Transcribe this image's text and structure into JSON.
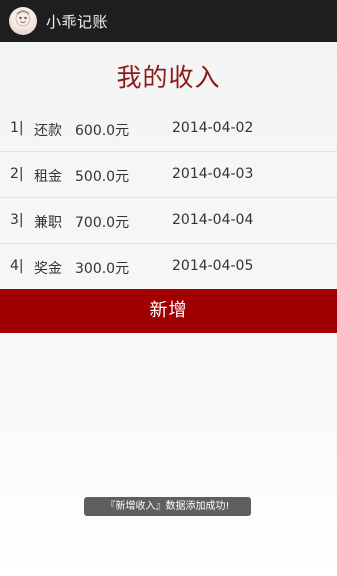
{
  "actionbar": {
    "app_title": "小乖记账",
    "app_icon": "app-logo-icon"
  },
  "page": {
    "title": "我的收入"
  },
  "income_list": [
    {
      "index": "1|",
      "category": "还款",
      "amount": "600.0元",
      "date": "2014-04-02"
    },
    {
      "index": "2|",
      "category": "租金",
      "amount": "500.0元",
      "date": "2014-04-03"
    },
    {
      "index": "3|",
      "category": "兼职",
      "amount": "700.0元",
      "date": "2014-04-04"
    },
    {
      "index": "4|",
      "category": "奖金",
      "amount": "300.0元",
      "date": "2014-04-05"
    }
  ],
  "add_button": {
    "label": "新增"
  },
  "toast": {
    "message": "『新增收入』数据添加成功!"
  },
  "colors": {
    "actionbar_bg": "#1e1e1e",
    "title_red": "#8b1a1a",
    "button_red": "#a00000",
    "toast_bg": "#5f5f5f"
  }
}
